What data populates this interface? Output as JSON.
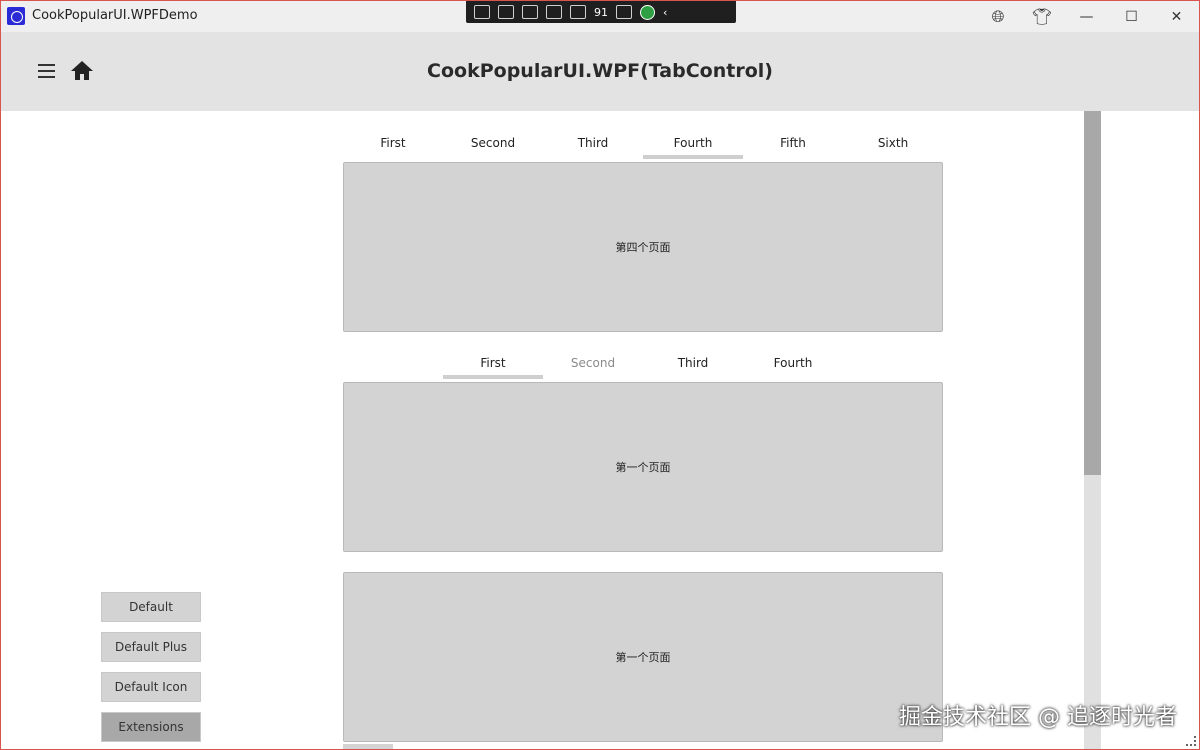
{
  "window": {
    "title": "CookPopularUI.WPFDemo",
    "debug_counter": "91",
    "border_color": "#d9534f"
  },
  "header": {
    "title": "CookPopularUI.WPF(TabControl)"
  },
  "tabs1": {
    "items": [
      "First",
      "Second",
      "Third",
      "Fourth",
      "Fifth",
      "Sixth"
    ],
    "content": "第四个页面"
  },
  "tabs2": {
    "items": [
      "First",
      "Second",
      "Third",
      "Fourth"
    ],
    "content": "第一个页面"
  },
  "tabs3": {
    "content": "第一个页面"
  },
  "side_buttons": [
    "Default",
    "Default Plus",
    "Default Icon",
    "Extensions"
  ],
  "watermark": "掘金技术社区 @ 追逐时光者",
  "icons": {
    "app": "app-logo-icon",
    "globe": "globe-icon",
    "theme": "tshirt-icon",
    "menu": "hamburger-menu-icon",
    "home": "home-icon"
  },
  "colors": {
    "header_bg": "#e3e3e3",
    "panel_bg": "#d3d3d3",
    "selected_indicator": "#cfcfcf",
    "active_button": "#a8a8a8"
  }
}
